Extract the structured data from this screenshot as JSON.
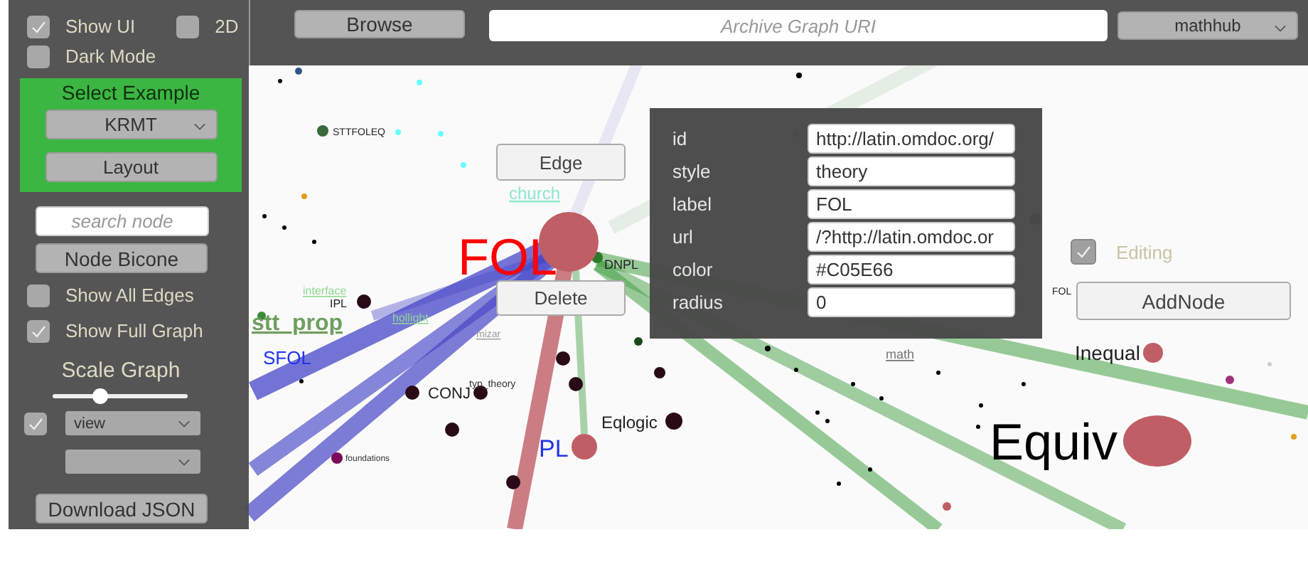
{
  "top_bar": {
    "browse_button": "Browse",
    "uri_field": {
      "placeholder": "Archive Graph URI"
    },
    "archive_dropdown": "mathhub"
  },
  "left_panel": {
    "checkboxes": [
      {
        "label": "Show UI",
        "checked": true
      },
      {
        "label": "2D",
        "checked": false
      },
      {
        "label": "Dark Mode",
        "checked": false
      }
    ],
    "example": {
      "title": "Select Example",
      "dropdown": "KRMT",
      "button": "Layout"
    },
    "search": {
      "placeholder": "search node"
    },
    "bicone_button": "Node Bicone",
    "toggles": [
      {
        "label": "Show All Edges",
        "checked": false
      },
      {
        "label": "Show Full Graph",
        "checked": true
      }
    ],
    "scale": {
      "label": "Scale Graph",
      "level": 0.35
    },
    "view": {
      "checked": true,
      "dropdown": "view"
    },
    "download_button": "Download JSON"
  },
  "graph": {
    "labels": [
      {
        "text": "STTFOLEQ",
        "color": "#222222",
        "kind": "node"
      },
      {
        "text": "church",
        "color": "#8ee8d0",
        "kind": "link"
      },
      {
        "text": "FOL",
        "color": "#ff0000",
        "kind": "node"
      },
      {
        "text": "DNPL",
        "color": "#222222",
        "kind": "node"
      },
      {
        "text": "interface",
        "color": "#90d890",
        "kind": "link"
      },
      {
        "text": "IPL",
        "color": "#222222",
        "kind": "node"
      },
      {
        "text": "hollight",
        "color": "#90d890",
        "kind": "link"
      },
      {
        "text": "stt_prop",
        "color": "#6f9f5f",
        "kind": "link"
      },
      {
        "text": "SFOL",
        "color": "#2233ee",
        "kind": "node"
      },
      {
        "text": "mizar",
        "color": "#9a9a9a",
        "kind": "link"
      },
      {
        "text": "typ_theory",
        "color": "#333333",
        "kind": "node"
      },
      {
        "text": "CONJ",
        "color": "#222222",
        "kind": "node"
      },
      {
        "text": "Eqlogic",
        "color": "#222222",
        "kind": "node"
      },
      {
        "text": "PL",
        "color": "#2233ee",
        "kind": "node"
      },
      {
        "text": "foundations",
        "color": "#333333",
        "kind": "node"
      },
      {
        "text": "math",
        "color": "#777777",
        "kind": "link"
      },
      {
        "text": "FOL",
        "color": "#222222",
        "kind": "node"
      },
      {
        "text": "Inequal",
        "color": "#222222",
        "kind": "node"
      },
      {
        "text": "Equiv",
        "color": "#000000",
        "kind": "node"
      }
    ]
  },
  "edge_button": "Edge",
  "delete_button": "Delete",
  "attributes": [
    {
      "name": "id",
      "value": "http://latin.omdoc.org/"
    },
    {
      "name": "style",
      "value": "theory"
    },
    {
      "name": "label",
      "value": "FOL"
    },
    {
      "name": "url",
      "value": "/?http://latin.omdoc.or"
    },
    {
      "name": "color",
      "value": "#C05E66"
    },
    {
      "name": "radius",
      "value": "0"
    }
  ],
  "editing": {
    "label": "Editing",
    "checked": true
  },
  "add_node_button": "AddNode"
}
